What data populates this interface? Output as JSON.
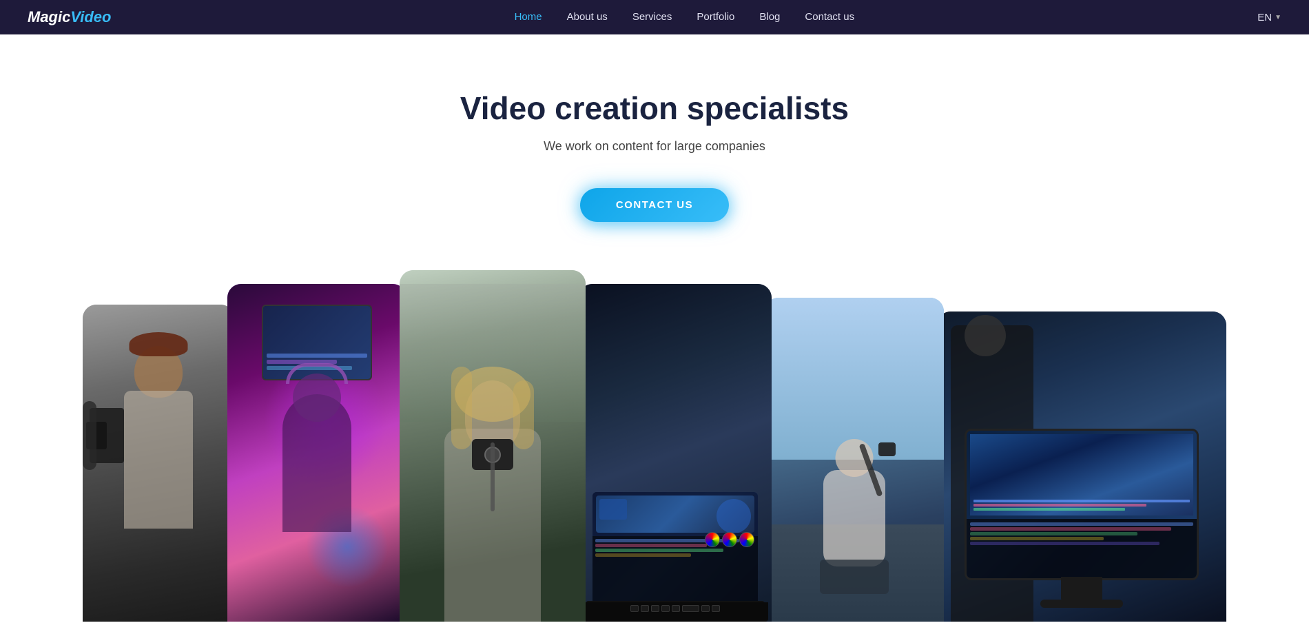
{
  "brand": {
    "name_magic": "Magic",
    "name_video": "Video"
  },
  "nav": {
    "links": [
      {
        "label": "Home",
        "active": true
      },
      {
        "label": "About us",
        "active": false
      },
      {
        "label": "Services",
        "active": false
      },
      {
        "label": "Portfolio",
        "active": false
      },
      {
        "label": "Blog",
        "active": false
      },
      {
        "label": "Contact us",
        "active": false
      }
    ],
    "lang": "EN",
    "lang_chevron": "▼"
  },
  "hero": {
    "title": "Video creation specialists",
    "subtitle": "We work on content for large companies",
    "cta_label": "CONTACT US"
  },
  "gallery": {
    "cards": [
      {
        "alt": "Videographer with camera"
      },
      {
        "alt": "Studio equipment with purple light"
      },
      {
        "alt": "Photographer with camera"
      },
      {
        "alt": "Video editing software"
      },
      {
        "alt": "Filmmaker with equipment"
      },
      {
        "alt": "iMac editing workstation"
      }
    ]
  }
}
